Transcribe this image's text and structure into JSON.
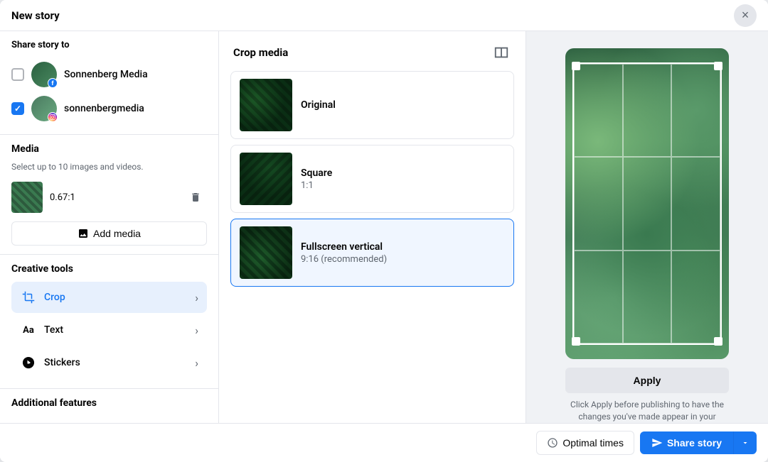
{
  "modal": {
    "title": "New story",
    "close_label": "×"
  },
  "left_panel": {
    "share_to_label": "Share story to",
    "accounts": [
      {
        "id": "sonnenberg-media",
        "name": "Sonnenberg Media",
        "checked": false,
        "platform": "facebook"
      },
      {
        "id": "sonnenbergmedia",
        "name": "sonnenbergmedia",
        "checked": true,
        "platform": "instagram"
      }
    ],
    "media": {
      "section_title": "Media",
      "subtitle": "Select up to 10 images and videos.",
      "items": [
        {
          "ratio": "0.67:1"
        }
      ],
      "add_media_label": "Add media"
    },
    "creative_tools": {
      "section_title": "Creative tools",
      "tools": [
        {
          "id": "crop",
          "label": "Crop",
          "icon": "✂",
          "active": true
        },
        {
          "id": "text",
          "label": "Text",
          "icon": "Aa",
          "active": false
        },
        {
          "id": "stickers",
          "label": "Stickers",
          "icon": "★",
          "active": false
        }
      ]
    },
    "additional_features": {
      "section_title": "Additional features"
    }
  },
  "middle_panel": {
    "crop_title": "Crop media",
    "options": [
      {
        "id": "original",
        "label": "Original",
        "ratio_label": "",
        "selected": false
      },
      {
        "id": "square",
        "label": "Square",
        "ratio_label": "1:1",
        "selected": false
      },
      {
        "id": "fullscreen-vertical",
        "label": "Fullscreen vertical",
        "ratio_label": "9:16 (recommended)",
        "selected": true
      }
    ]
  },
  "right_panel": {
    "apply_button_label": "Apply",
    "apply_hint": "Click Apply before publishing to have the changes you've made appear in your published story."
  },
  "footer": {
    "optimal_times_label": "Optimal times",
    "share_story_label": "Share story"
  }
}
